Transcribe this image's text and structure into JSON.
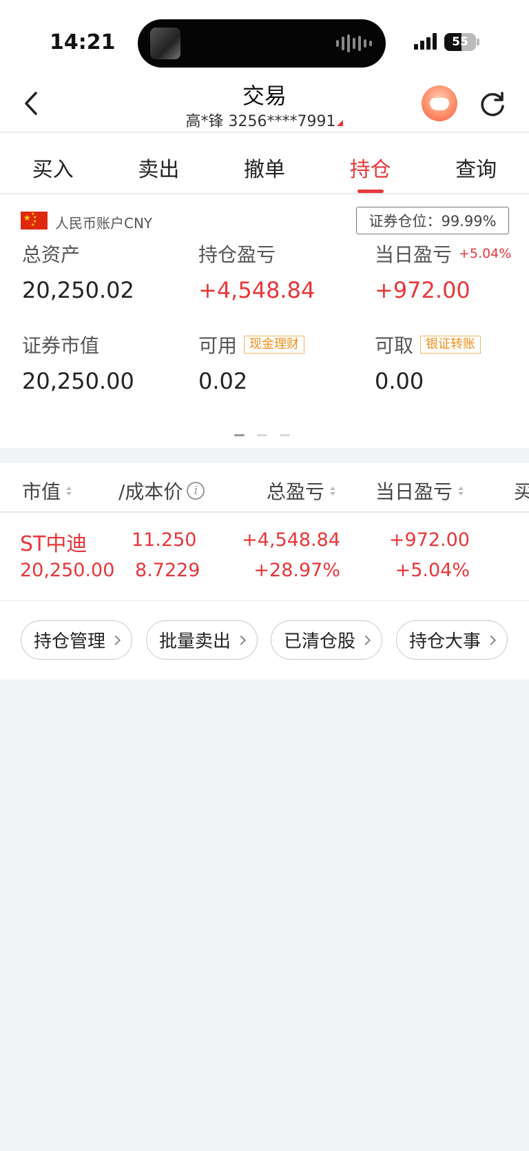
{
  "status_bar": {
    "time": "14:21",
    "battery": "55"
  },
  "header": {
    "title": "交易",
    "account": "高*锋 3256****7991"
  },
  "tabs": [
    {
      "label": "买入"
    },
    {
      "label": "卖出"
    },
    {
      "label": "撤单"
    },
    {
      "label": "持仓",
      "active": true
    },
    {
      "label": "查询"
    }
  ],
  "account_summary": {
    "currency_label": "人民币账户CNY",
    "position_ratio": "证券仓位：99.99%",
    "total_assets": {
      "label": "总资产",
      "value": "20,250.02"
    },
    "holding_pnl": {
      "label": "持仓盈亏",
      "value": "+4,548.84"
    },
    "daily_pnl": {
      "label": "当日盈亏",
      "percent": "+5.04%",
      "value": "+972.00"
    },
    "securities_value": {
      "label": "证券市值",
      "value": "20,250.00"
    },
    "available": {
      "label": "可用",
      "tag": "现金理财",
      "value": "0.02"
    },
    "withdrawable": {
      "label": "可取",
      "tag": "银证转账",
      "value": "0.00"
    }
  },
  "holdings": {
    "columns": [
      "市值",
      "/成本价",
      "总盈亏",
      "当日盈亏",
      "买"
    ],
    "rows": [
      {
        "name": "ST中迪",
        "market_value": "20,250.00",
        "price": "11.250",
        "cost": "8.7229",
        "total_pnl": "+4,548.84",
        "total_pnl_pct": "+28.97%",
        "daily_pnl": "+972.00",
        "daily_pnl_pct": "+5.04%"
      }
    ],
    "actions": [
      "持仓管理",
      "批量卖出",
      "已清仓股",
      "持仓大事"
    ]
  },
  "colors": {
    "accent_red": "#e8363a",
    "tag_orange": "#f08f1a",
    "background": "#f2f3f7"
  }
}
